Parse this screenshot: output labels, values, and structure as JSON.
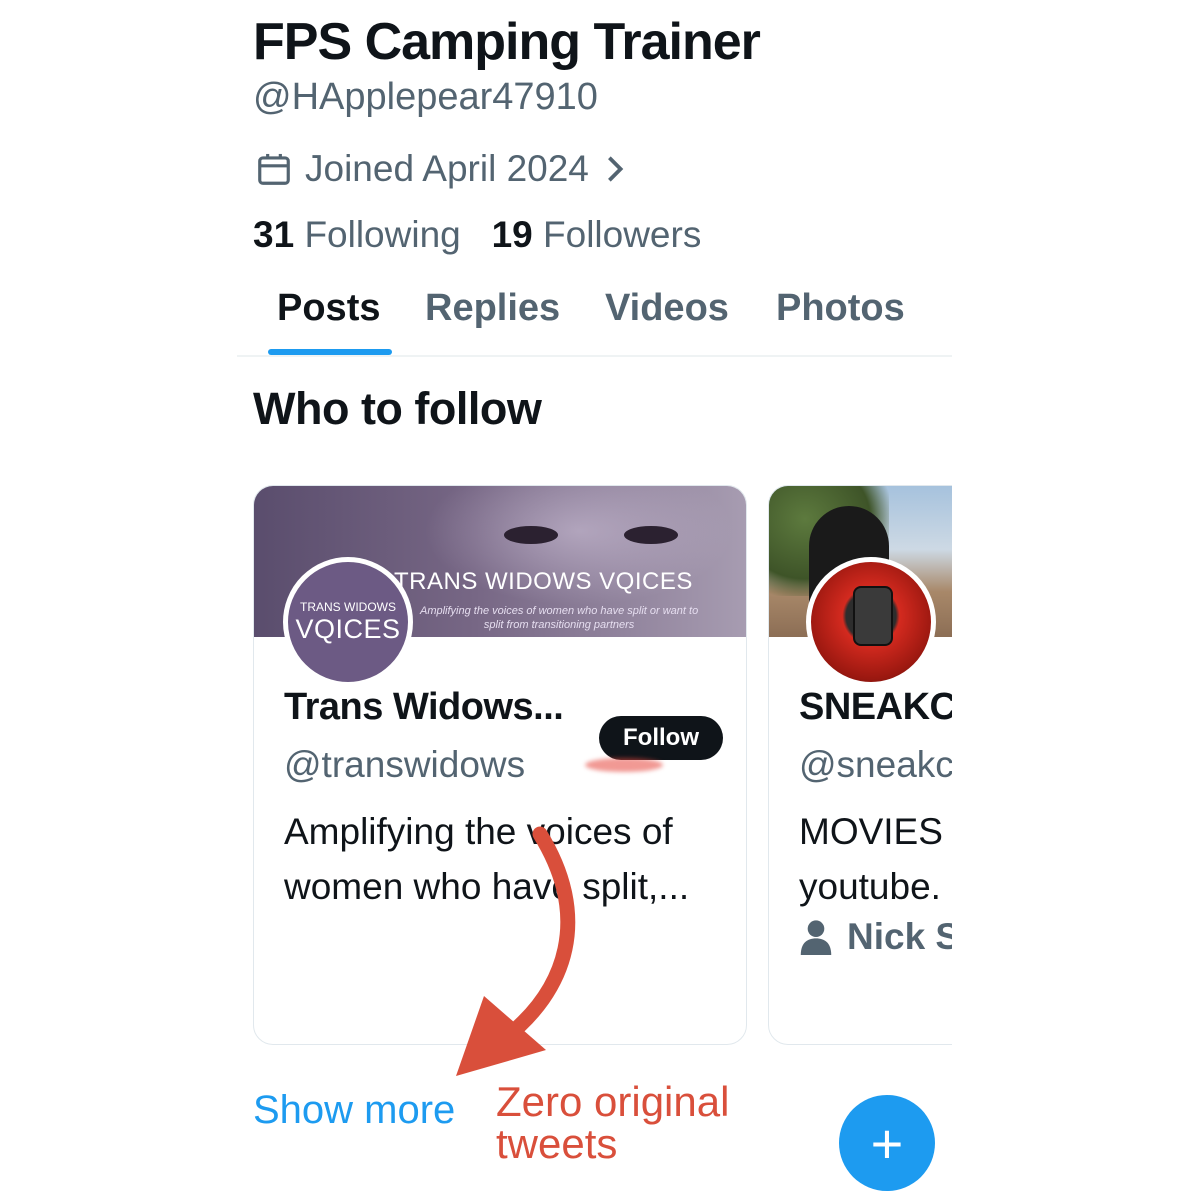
{
  "profile": {
    "display_name": "FPS Camping Trainer",
    "handle": "@HApplepear47910",
    "joined": "Joined April 2024",
    "following_count": "31",
    "following_label": "Following",
    "followers_count": "19",
    "followers_label": "Followers"
  },
  "tabs": [
    {
      "label": "Posts",
      "active": true
    },
    {
      "label": "Replies",
      "active": false
    },
    {
      "label": "Videos",
      "active": false
    },
    {
      "label": "Photos",
      "active": false
    }
  ],
  "who_to_follow": {
    "title": "Who to follow",
    "cards": [
      {
        "name": "Trans Widows...",
        "handle": "@transwidows",
        "bio": "Amplifying the voices of women who have split,...",
        "follow_label": "Follow",
        "banner_title": "TRANS WIDOWS VQICES",
        "banner_subtitle_1": "Amplifying the voices of women who have split or want to",
        "banner_subtitle_2": "split from transitioning partners",
        "avatar_small": "TRANS WIDOWS",
        "avatar_big": "VQICES"
      },
      {
        "name": "SNEAKC",
        "handle": "@sneakc",
        "bio_line_1": "MOVIES",
        "bio_line_2": "youtube.",
        "meta_icon": "person-icon",
        "meta": "Nick S"
      }
    ],
    "show_more": "Show more"
  },
  "annotation": {
    "line_1": "Zero original",
    "line_2": "tweets",
    "color": "#d94f3b"
  },
  "fab": {
    "icon": "plus-icon",
    "label": "+"
  },
  "colors": {
    "accent": "#1d9bf0",
    "text_primary": "#0f1419",
    "text_secondary": "#536471"
  }
}
